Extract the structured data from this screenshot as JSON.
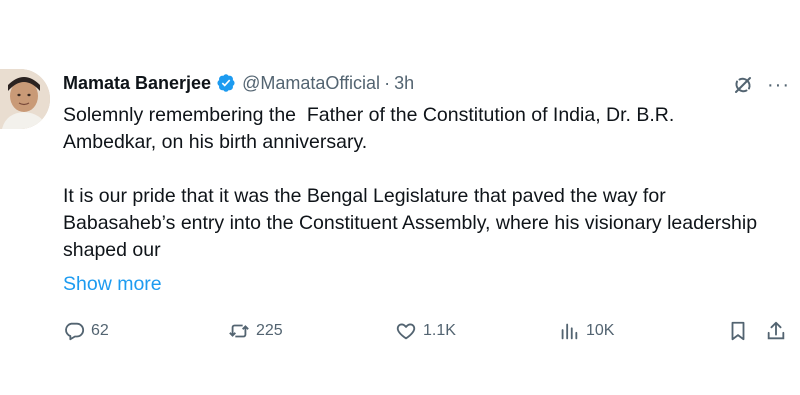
{
  "tweet": {
    "author_name": "Mamata Banerjee",
    "handle": "@MamataOfficial",
    "separator": "·",
    "time": "3h",
    "paragraph1": "Solemnly remembering the  Father of the Constitution of India, Dr. B.R. Ambedkar, on his birth anniversary.",
    "paragraph2": "It is our pride that it was the Bengal Legislature that paved the way for Babasaheb’s entry into the Constituent Assembly, where his visionary leadership shaped our",
    "show_more": "Show more",
    "more_menu": "···"
  },
  "actions": {
    "replies": "62",
    "reposts": "225",
    "likes": "1.1K",
    "views": "10K"
  },
  "icons": [
    "verified-badge-icon",
    "grok-icon",
    "more-icon",
    "reply-icon",
    "repost-icon",
    "like-icon",
    "views-icon",
    "bookmark-icon",
    "share-icon"
  ],
  "colors": {
    "accent": "#1d9bf0",
    "muted": "#536471",
    "text": "#0f1419"
  }
}
